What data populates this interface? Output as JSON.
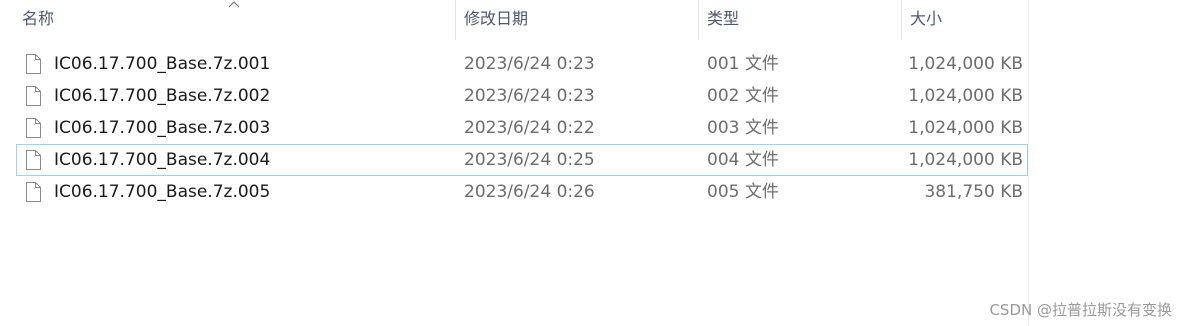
{
  "columns": {
    "name": "名称",
    "date_modified": "修改日期",
    "type": "类型",
    "size": "大小"
  },
  "files": [
    {
      "name": "IC06.17.700_Base.7z.001",
      "date": "2023/6/24 0:23",
      "type": "001 文件",
      "size": "1,024,000 KB"
    },
    {
      "name": "IC06.17.700_Base.7z.002",
      "date": "2023/6/24 0:23",
      "type": "002 文件",
      "size": "1,024,000 KB"
    },
    {
      "name": "IC06.17.700_Base.7z.003",
      "date": "2023/6/24 0:22",
      "type": "003 文件",
      "size": "1,024,000 KB"
    },
    {
      "name": "IC06.17.700_Base.7z.004",
      "date": "2023/6/24 0:25",
      "type": "004 文件",
      "size": "1,024,000 KB"
    },
    {
      "name": "IC06.17.700_Base.7z.005",
      "date": "2023/6/24 0:26",
      "type": "005 文件",
      "size": "381,750 KB"
    }
  ],
  "focused_index": 3,
  "sort": {
    "column": "name",
    "direction": "ascending",
    "icon": "chevron-up-icon"
  },
  "file_icon": "document-icon",
  "watermark": "CSDN @拉普拉斯没有变换",
  "colors": {
    "header_text": "#4b5970",
    "secondary_text": "#6d6d6d",
    "focus_border": "#99d1ff",
    "divider": "#e5e5e5"
  }
}
